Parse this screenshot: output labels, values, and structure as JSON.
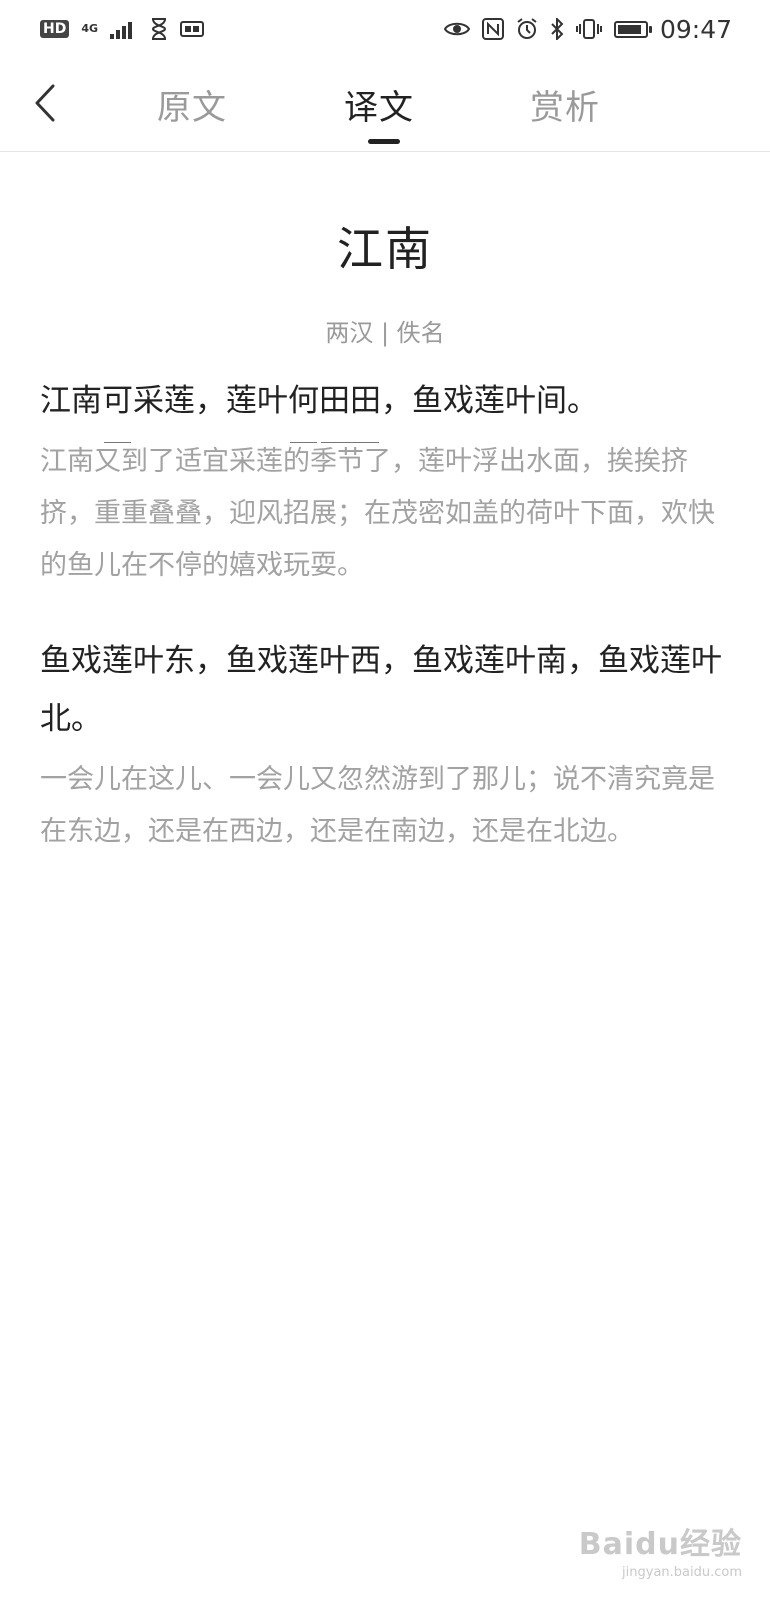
{
  "status_bar": {
    "left": {
      "hd": "HD",
      "network": "4G"
    },
    "time": "09:47",
    "battery_level": 0.9
  },
  "nav": {
    "tabs": [
      {
        "label": "原文"
      },
      {
        "label": "译文"
      },
      {
        "label": "赏析"
      }
    ],
    "active_tab": "译文"
  },
  "poem": {
    "title": "江南",
    "author": "两汉 | 佚名",
    "stanzas": [
      {
        "original_parts": [
          "江南",
          "可",
          "采莲，莲叶",
          "何",
          "田田",
          "，鱼戏莲叶间。"
        ],
        "translation": "江南又到了适宜采莲的季节了，莲叶浮出水面，挨挨挤挤，重重叠叠，迎风招展；在茂密如盖的荷叶下面，欢快的鱼儿在不停的嬉戏玩耍。"
      },
      {
        "original": "鱼戏莲叶东，鱼戏莲叶西，鱼戏莲叶南，鱼戏莲叶北。",
        "translation": "一会儿在这儿、一会儿又忽然游到了那儿；说不清究竟是在东边，还是在西边，还是在南边，还是在北边。"
      }
    ]
  },
  "watermark": {
    "main": "Baidu经验",
    "url": "jingyan.baidu.com"
  }
}
